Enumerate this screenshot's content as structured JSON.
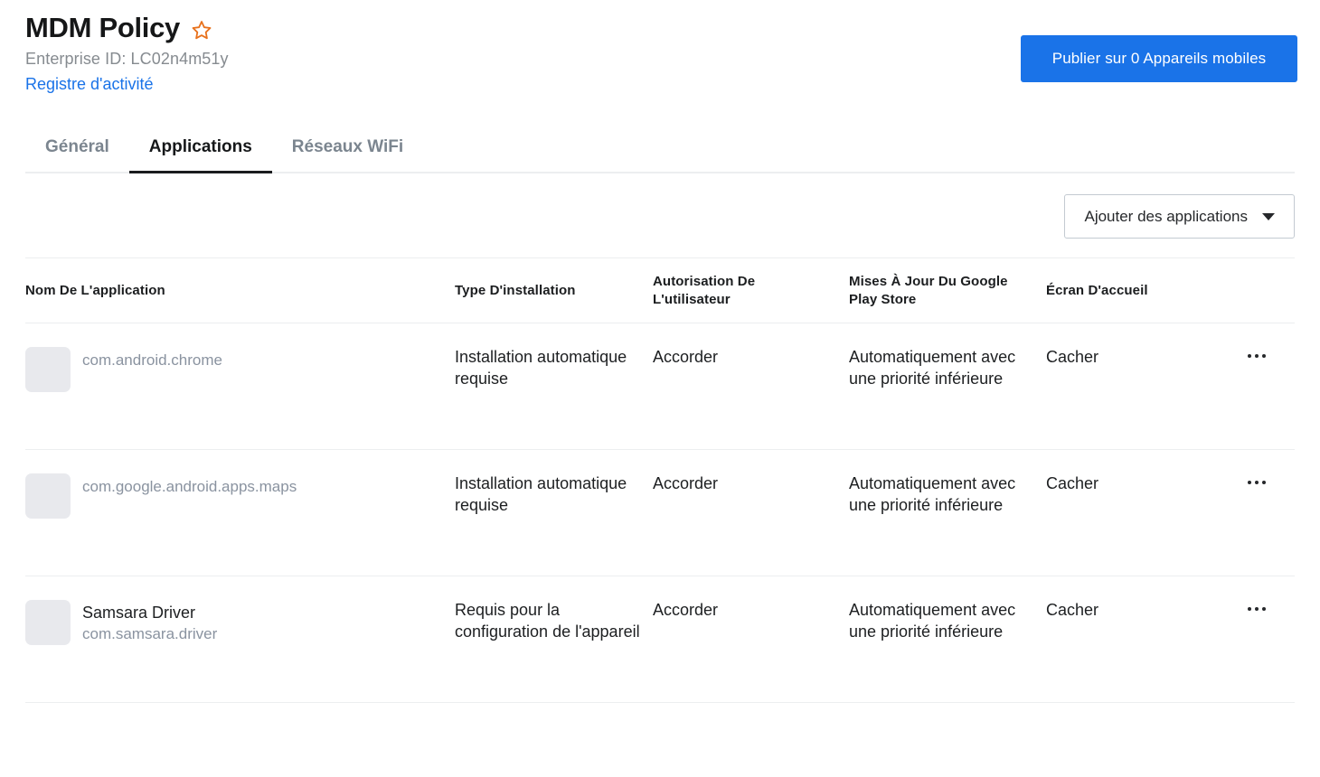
{
  "header": {
    "title": "MDM Policy",
    "favorite_icon": "star-icon",
    "favorite_color": "#e8711c",
    "enterprise_id": "Enterprise ID: LC02n4m51y",
    "activity_log_link": "Registre d'activité",
    "publish_button": "Publier sur 0 Appareils mobiles",
    "publish_color": "#1a73e8"
  },
  "tabs": [
    {
      "label": "Général",
      "active": false
    },
    {
      "label": "Applications",
      "active": true
    },
    {
      "label": "Réseaux WiFi",
      "active": false
    }
  ],
  "toolbar": {
    "add_apps_label": "Ajouter des applications",
    "add_apps_icon": "chevron-down-icon"
  },
  "table": {
    "columns": [
      "Nom De L'application",
      "Type D'installation",
      "Autorisation De L'utilisateur",
      "Mises À Jour Du Google Play Store",
      "Écran D'accueil"
    ],
    "rows": [
      {
        "app_name": "",
        "package": "com.android.chrome",
        "install_type": "Installation automatique requise",
        "user_permission": "Accorder",
        "play_store_updates": "Automatiquement avec une priorité inférieure",
        "home_screen": "Cacher",
        "menu_icon": "kebab-menu-icon"
      },
      {
        "app_name": "",
        "package": "com.google.android.apps.maps",
        "install_type": "Installation automatique requise",
        "user_permission": "Accorder",
        "play_store_updates": "Automatiquement avec une priorité inférieure",
        "home_screen": "Cacher",
        "menu_icon": "kebab-menu-icon"
      },
      {
        "app_name": "Samsara Driver",
        "package": "com.samsara.driver",
        "install_type": "Requis pour la configuration de l'appareil",
        "user_permission": "Accorder",
        "play_store_updates": "Automatiquement avec une priorité inférieure",
        "home_screen": "Cacher",
        "menu_icon": "kebab-menu-icon"
      }
    ]
  }
}
